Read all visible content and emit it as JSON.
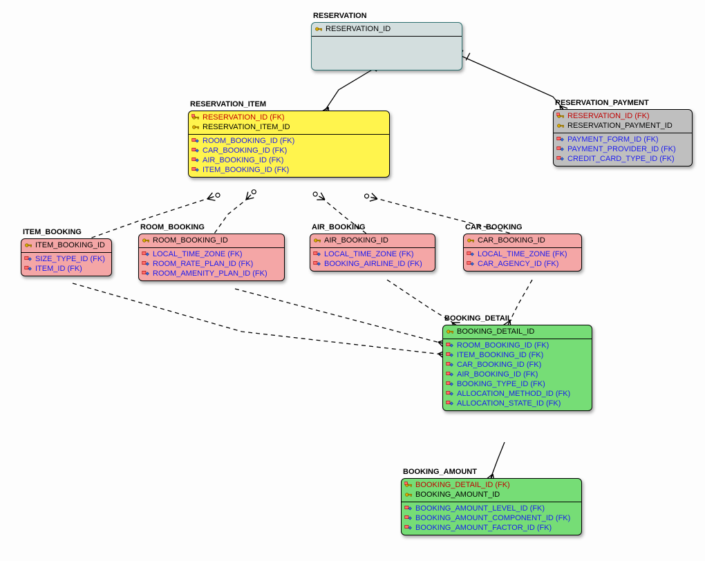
{
  "entities": {
    "reservation": {
      "title": "RESERVATION",
      "pk": [
        {
          "icon": "pk",
          "text": "RESERVATION_ID",
          "cls": "txt"
        }
      ],
      "attrs": []
    },
    "reservation_payment": {
      "title": "RESERVATION_PAYMENT",
      "pk": [
        {
          "icon": "pkfk",
          "text": "RESERVATION_ID (FK)",
          "cls": "txt-red"
        },
        {
          "icon": "pk",
          "text": "RESERVATION_PAYMENT_ID",
          "cls": "txt"
        }
      ],
      "attrs": [
        {
          "icon": "fk",
          "text": "PAYMENT_FORM_ID (FK)",
          "cls": "txt-blue"
        },
        {
          "icon": "fk",
          "text": "PAYMENT_PROVIDER_ID (FK)",
          "cls": "txt-blue"
        },
        {
          "icon": "fk",
          "text": "CREDIT_CARD_TYPE_ID (FK)",
          "cls": "txt-blue"
        }
      ]
    },
    "reservation_item": {
      "title": "RESERVATION_ITEM",
      "pk": [
        {
          "icon": "pkfk",
          "text": "RESERVATION_ID (FK)",
          "cls": "txt-red"
        },
        {
          "icon": "pk",
          "text": "RESERVATION_ITEM_ID",
          "cls": "txt"
        }
      ],
      "attrs": [
        {
          "icon": "fk",
          "text": "ROOM_BOOKING_ID (FK)",
          "cls": "txt-blue"
        },
        {
          "icon": "fk",
          "text": "CAR_BOOKING_ID (FK)",
          "cls": "txt-blue"
        },
        {
          "icon": "fk",
          "text": "AIR_BOOKING_ID (FK)",
          "cls": "txt-blue"
        },
        {
          "icon": "fk",
          "text": "ITEM_BOOKING_ID (FK)",
          "cls": "txt-blue"
        }
      ]
    },
    "item_booking": {
      "title": "ITEM_BOOKING",
      "pk": [
        {
          "icon": "pk",
          "text": "ITEM_BOOKING_ID",
          "cls": "txt"
        }
      ],
      "attrs": [
        {
          "icon": "fk",
          "text": "SIZE_TYPE_ID (FK)",
          "cls": "txt-blue"
        },
        {
          "icon": "fk",
          "text": "ITEM_ID (FK)",
          "cls": "txt-blue"
        }
      ]
    },
    "room_booking": {
      "title": "ROOM_BOOKING",
      "pk": [
        {
          "icon": "pk",
          "text": "ROOM_BOOKING_ID",
          "cls": "txt"
        }
      ],
      "attrs": [
        {
          "icon": "fk",
          "text": "LOCAL_TIME_ZONE (FK)",
          "cls": "txt-blue"
        },
        {
          "icon": "fk",
          "text": "ROOM_RATE_PLAN_ID (FK)",
          "cls": "txt-blue"
        },
        {
          "icon": "fk",
          "text": "ROOM_AMENITY_PLAN_ID (FK)",
          "cls": "txt-blue"
        }
      ]
    },
    "air_booking": {
      "title": "AIR_BOOKING",
      "pk": [
        {
          "icon": "pk",
          "text": "AIR_BOOKING_ID",
          "cls": "txt"
        }
      ],
      "attrs": [
        {
          "icon": "fk",
          "text": "LOCAL_TIME_ZONE (FK)",
          "cls": "txt-blue"
        },
        {
          "icon": "fk",
          "text": "BOOKING_AIRLINE_ID (FK)",
          "cls": "txt-blue"
        }
      ]
    },
    "car_booking": {
      "title": "CAR_BOOKING",
      "pk": [
        {
          "icon": "pk",
          "text": "CAR_BOOKING_ID",
          "cls": "txt"
        }
      ],
      "attrs": [
        {
          "icon": "fk",
          "text": "LOCAL_TIME_ZONE (FK)",
          "cls": "txt-blue"
        },
        {
          "icon": "fk",
          "text": "CAR_AGENCY_ID (FK)",
          "cls": "txt-blue"
        }
      ]
    },
    "booking_detail": {
      "title": "BOOKING_DETAIL",
      "pk": [
        {
          "icon": "pk",
          "text": "BOOKING_DETAIL_ID",
          "cls": "txt"
        }
      ],
      "attrs": [
        {
          "icon": "fk",
          "text": "ROOM_BOOKING_ID (FK)",
          "cls": "txt-blue"
        },
        {
          "icon": "fk",
          "text": "ITEM_BOOKING_ID (FK)",
          "cls": "txt-blue"
        },
        {
          "icon": "fk",
          "text": "CAR_BOOKING_ID (FK)",
          "cls": "txt-blue"
        },
        {
          "icon": "fk",
          "text": "AIR_BOOKING_ID (FK)",
          "cls": "txt-blue"
        },
        {
          "icon": "fk",
          "text": "BOOKING_TYPE_ID (FK)",
          "cls": "txt-blue"
        },
        {
          "icon": "fk",
          "text": "ALLOCATION_METHOD_ID (FK)",
          "cls": "txt-blue"
        },
        {
          "icon": "fk",
          "text": "ALLOCATION_STATE_ID (FK)",
          "cls": "txt-blue"
        }
      ]
    },
    "booking_amount": {
      "title": "BOOKING_AMOUNT",
      "pk": [
        {
          "icon": "pkfk",
          "text": "BOOKING_DETAIL_ID (FK)",
          "cls": "txt-red"
        },
        {
          "icon": "pk",
          "text": "BOOKING_AMOUNT_ID",
          "cls": "txt"
        }
      ],
      "attrs": [
        {
          "icon": "fk",
          "text": "BOOKING_AMOUNT_LEVEL_ID (FK)",
          "cls": "txt-blue"
        },
        {
          "icon": "fk",
          "text": "BOOKING_AMOUNT_COMPONENT_ID (FK)",
          "cls": "txt-blue"
        },
        {
          "icon": "fk",
          "text": "BOOKING_AMOUNT_FACTOR_ID (FK)",
          "cls": "txt-blue"
        }
      ]
    }
  }
}
